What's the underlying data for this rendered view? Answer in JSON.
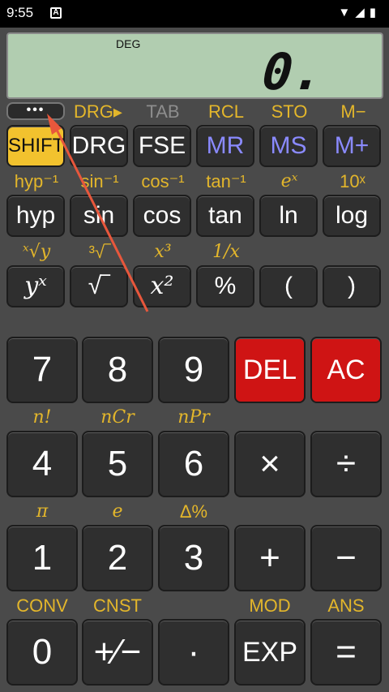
{
  "status": {
    "time": "9:55",
    "notif_icon": "A",
    "icons": "▼◢▮"
  },
  "display": {
    "mode": "DEG",
    "value": "0."
  },
  "menu": {
    "label": "•••"
  },
  "row1_labels": [
    "DRG▸",
    "TAB",
    "RCL",
    "STO",
    "M−"
  ],
  "row1": [
    "SHIFT",
    "DRG",
    "FSE",
    "MR",
    "MS",
    "M+"
  ],
  "row2_labels": [
    "hyp⁻¹",
    "sin⁻¹",
    "cos⁻¹",
    "tan⁻¹",
    "eˣ",
    "10ˣ"
  ],
  "row2": [
    "hyp",
    "sin",
    "cos",
    "tan",
    "ln",
    "log"
  ],
  "row3_labels": [
    "ˣ√y",
    "³√‾",
    "x³",
    "1/x"
  ],
  "row3": [
    "yˣ",
    "√‾",
    "x²",
    "%",
    "(",
    ")"
  ],
  "num_row1": [
    "7",
    "8",
    "9",
    "DEL",
    "AC"
  ],
  "num_row2_labels": [
    "n!",
    "nCr",
    "nPr"
  ],
  "num_row2": [
    "4",
    "5",
    "6",
    "×",
    "÷"
  ],
  "num_row3_labels": [
    "π",
    "e",
    "Δ%"
  ],
  "num_row3": [
    "1",
    "2",
    "3",
    "+",
    "−"
  ],
  "num_row4_labels": [
    "CONV",
    "CNST",
    "MOD",
    "ANS"
  ],
  "num_row4": [
    "0",
    "+⁄−",
    "·",
    "EXP",
    "="
  ]
}
